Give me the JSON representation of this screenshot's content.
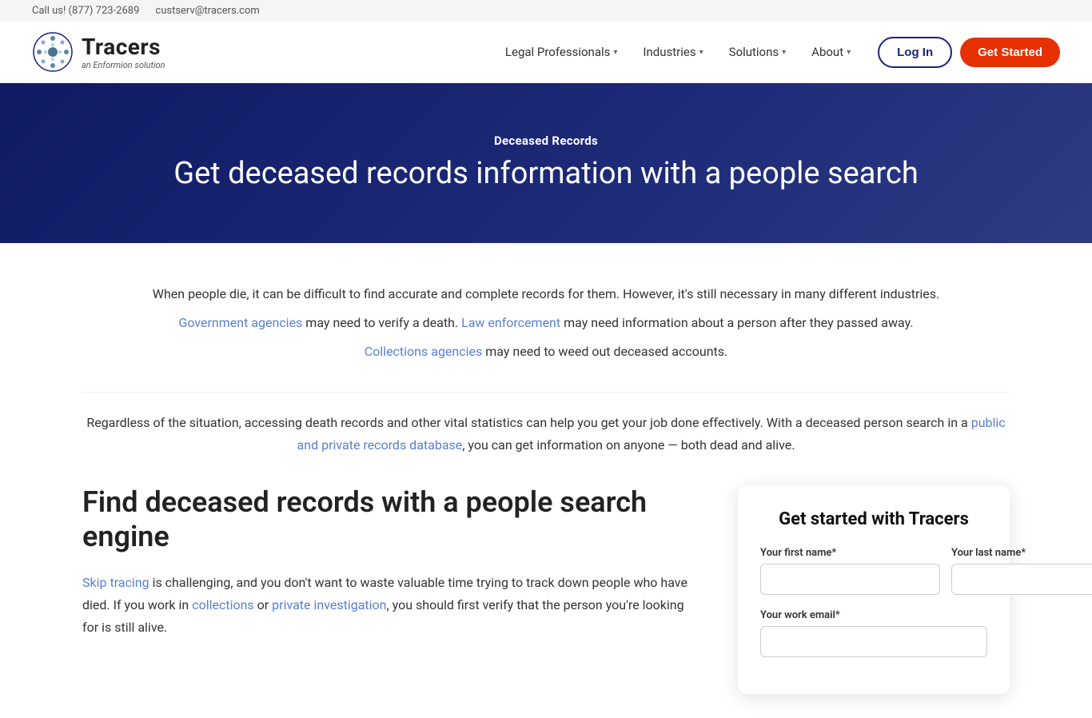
{
  "topbar": {
    "phone_label": "Call us! (877) 723-2689",
    "email_label": "custserv@tracers.com"
  },
  "header": {
    "logo_name": "Tracers",
    "logo_sub": "an Enformion solution",
    "nav": [
      {
        "label": "Legal Professionals",
        "has_dropdown": true
      },
      {
        "label": "Industries",
        "has_dropdown": true
      },
      {
        "label": "Solutions",
        "has_dropdown": true
      },
      {
        "label": "About",
        "has_dropdown": true
      }
    ],
    "login_label": "Log In",
    "started_label": "Get Started"
  },
  "hero": {
    "label": "Deceased Records",
    "title": "Get deceased records information with a people search"
  },
  "intro": {
    "para1": "When people die, it can be difficult to find accurate and complete records for them. However, it's still necessary in many different industries.",
    "para2_pre": "",
    "link1": "Government agencies",
    "para2_mid1": " may need to verify a death. ",
    "link2": "Law enforcement",
    "para2_mid2": " may need information about a person after they passed away.",
    "link3": "Collections agencies",
    "para2_end": " may need to weed out deceased accounts.",
    "para3": "Regardless of the situation, accessing death records and other vital statistics can help you get your job done effectively. With a deceased person search in a ",
    "link4": "public and private records database",
    "para3_end": ", you can get information on anyone — both dead and alive."
  },
  "section": {
    "title": "Find deceased records with a people search engine",
    "body_pre": "",
    "link_skip": "Skip tracing",
    "body_mid1": " is challenging, and you don't want to waste valuable time trying to track down people who have died. If you work in ",
    "link_collections": "collections",
    "body_mid2": " or ",
    "link_pi": "private investigation",
    "body_end": ", you should first verify that the person you're looking for is still alive."
  },
  "form": {
    "title": "Get started with Tracers",
    "first_name_label": "Your first name*",
    "last_name_label": "Your last name*",
    "email_label": "Your work email*"
  }
}
